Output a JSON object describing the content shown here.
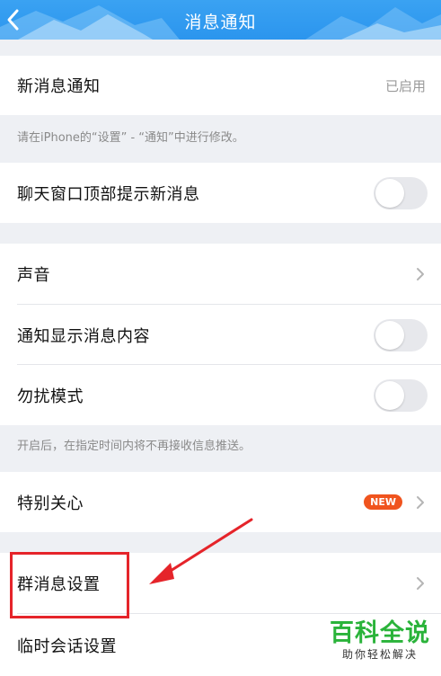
{
  "header": {
    "title": "消息通知",
    "back_icon": "chevron-left-icon"
  },
  "sections": {
    "new_message": {
      "label": "新消息通知",
      "status": "已启用"
    },
    "new_message_hint": "请在iPhone的“设置” - “通知”中进行修改。",
    "chat_top_hint": {
      "label": "聊天窗口顶部提示新消息",
      "enabled": false
    },
    "sound": {
      "label": "声音"
    },
    "show_content": {
      "label": "通知显示消息内容",
      "enabled": false
    },
    "dnd": {
      "label": "勿扰模式",
      "enabled": false
    },
    "dnd_hint": "开启后，在指定时间内将不再接收信息推送。",
    "special_care": {
      "label": "特别关心",
      "badge": "NEW"
    },
    "group_settings": {
      "label": "群消息设置"
    },
    "temp_chat": {
      "label": "临时会话设置"
    }
  },
  "watermark": {
    "main": "百科全说",
    "sub": "助你轻松解决"
  },
  "colors": {
    "header": "#2b95ee",
    "badge": "#f0541e",
    "highlight": "#e5242a",
    "watermark": "#2ab33a"
  }
}
